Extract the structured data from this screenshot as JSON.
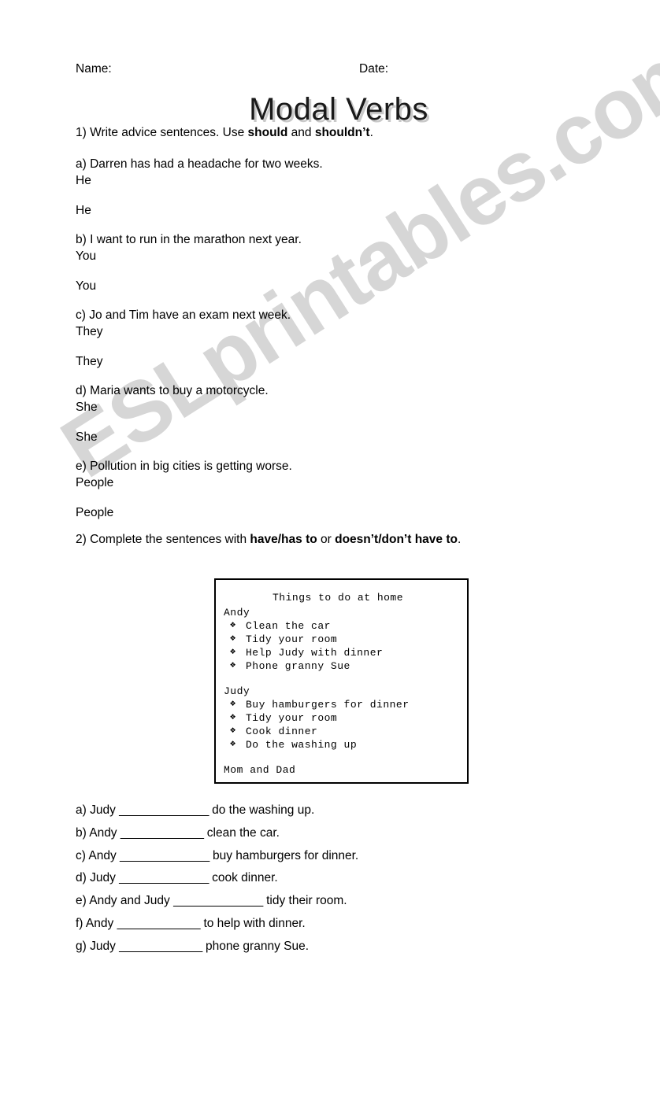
{
  "page": {
    "background_color": "#ffffff",
    "text_color": "#000000"
  },
  "header": {
    "name_label": "Name:",
    "date_label": "Date:",
    "title": "Modal Verbs",
    "title_shadow_color": "#c9c9c9"
  },
  "watermark": {
    "text": "ESLprintables.com",
    "color": "#d6d6d6",
    "rotation_degrees": -32.5
  },
  "exercise1": {
    "instruction_prefix": "1) Write advice sentences. Use ",
    "instruction_bold_1": "should",
    "instruction_mid": " and ",
    "instruction_bold_2": "shouldn’t",
    "instruction_suffix": ".",
    "items": [
      {
        "prompt": "a) Darren has had a headache for two weeks.",
        "line1": "He",
        "line2": "He"
      },
      {
        "prompt": "b) I want to run in the marathon next year.",
        "line1": "You",
        "line2": "You"
      },
      {
        "prompt": "c) Jo and Tim have an exam next week.",
        "line1": "They",
        "line2": "They"
      },
      {
        "prompt": "d) Maria wants to buy a motorcycle.",
        "line1": "She",
        "line2": "She"
      },
      {
        "prompt": "e) Pollution in big cities is getting worse.",
        "line1": "People",
        "line2": "People"
      }
    ]
  },
  "exercise2": {
    "instruction_prefix": "2) Complete the sentences with ",
    "instruction_bold_1": "have/has to",
    "instruction_mid": " or ",
    "instruction_bold_2": "doesn’t/don’t have to",
    "instruction_suffix": ".",
    "task_box": {
      "title": "Things to do at home",
      "bullet_glyph": "❖",
      "groups": [
        {
          "person": "Andy",
          "tasks": [
            "Clean the car",
            "Tidy your room",
            "Help Judy with dinner",
            "Phone granny Sue"
          ]
        },
        {
          "person": "Judy",
          "tasks": [
            "Buy hamburgers for dinner",
            "Tidy your room",
            "Cook dinner",
            "Do the washing up"
          ]
        }
      ],
      "footer_person": "Mom and Dad"
    },
    "questions": [
      {
        "before": "a) Judy ",
        "blank": "______________",
        "after": " do the washing up."
      },
      {
        "before": "b) Andy ",
        "blank": "_____________",
        "after": " clean the car."
      },
      {
        "before": "c) Andy ",
        "blank": "______________",
        "after": " buy hamburgers for dinner."
      },
      {
        "before": "d) Judy ",
        "blank": "______________",
        "after": " cook dinner."
      },
      {
        "before": "e) Andy and Judy ",
        "blank": "______________",
        "after": " tidy their room."
      },
      {
        "before": "f) Andy ",
        "blank": "_____________",
        "after": " to help with dinner."
      },
      {
        "before": "g) Judy ",
        "blank": "_____________",
        "after": " phone granny Sue."
      }
    ]
  }
}
